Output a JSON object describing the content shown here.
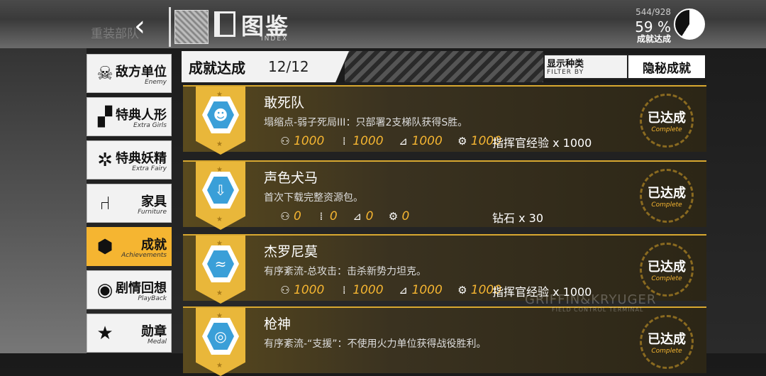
{
  "header": {
    "title": "图鉴",
    "subtitle": "INDEX",
    "progress_count": "544/928",
    "progress_percent": "59 %",
    "progress_label": "成就达成",
    "progress_fraction": 0.59
  },
  "ghost_item": "重装部队",
  "nav": [
    {
      "cn": "敌方单位",
      "en": "Enemy",
      "icon": "enemy-icon",
      "glyph": "☠"
    },
    {
      "cn": "特典人形",
      "en": "Extra Girls",
      "icon": "extra-girls-icon",
      "glyph": "▞"
    },
    {
      "cn": "特典妖精",
      "en": "Extra Fairy",
      "icon": "extra-fairy-icon",
      "glyph": "✲"
    },
    {
      "cn": "家具",
      "en": "Furniture",
      "icon": "chair-icon",
      "glyph": "⑁"
    },
    {
      "cn": "成就",
      "en": "Achievements",
      "icon": "achievement-icon",
      "glyph": "⬢"
    },
    {
      "cn": "剧情回想",
      "en": "PlayBack",
      "icon": "playback-icon",
      "glyph": "◉"
    },
    {
      "cn": "勋章",
      "en": "Medal",
      "icon": "medal-icon",
      "glyph": "★"
    }
  ],
  "section": {
    "title": "成就达成",
    "count": "12/12",
    "filter_label": "显示种类",
    "filter_sub": "FILTER BY",
    "filter_value": "隐秘成就"
  },
  "achievements": [
    {
      "title": "敢死队",
      "desc": "塌缩点-弱子死局III：只部署2支梯队获得S胜。",
      "r1": "1000",
      "r2": "1000",
      "r3": "1000",
      "r4": "1000",
      "extra": "指挥官经验 x 1000",
      "status_cn": "已达成",
      "status_en": "Complete",
      "icon": "squad-icon",
      "glyph": "☻"
    },
    {
      "title": "声色犬马",
      "desc": "首次下载完整资源包。",
      "r1": "0",
      "r2": "0",
      "r3": "0",
      "r4": "0",
      "extra": "钻石 x 30",
      "status_cn": "已达成",
      "status_en": "Complete",
      "icon": "download-icon",
      "glyph": "⇩"
    },
    {
      "title": "杰罗尼莫",
      "desc": "有序紊流-总攻击：击杀新势力坦克。",
      "r1": "1000",
      "r2": "1000",
      "r3": "1000",
      "r4": "1000",
      "extra": "指挥官经验 x 1000",
      "status_cn": "已达成",
      "status_en": "Complete",
      "icon": "dolphin-icon",
      "glyph": "≈"
    },
    {
      "title": "枪神",
      "desc": "有序紊流-“支援”：不使用火力单位获得战役胜利。",
      "r1": "",
      "r2": "",
      "r3": "",
      "r4": "",
      "extra": "",
      "status_cn": "已达成",
      "status_en": "Complete",
      "icon": "target-icon",
      "glyph": "◎"
    }
  ],
  "watermark": "GRIFFIN&KRYUGER",
  "watermark_sub": "FIELD CONTROL TERMINAL"
}
